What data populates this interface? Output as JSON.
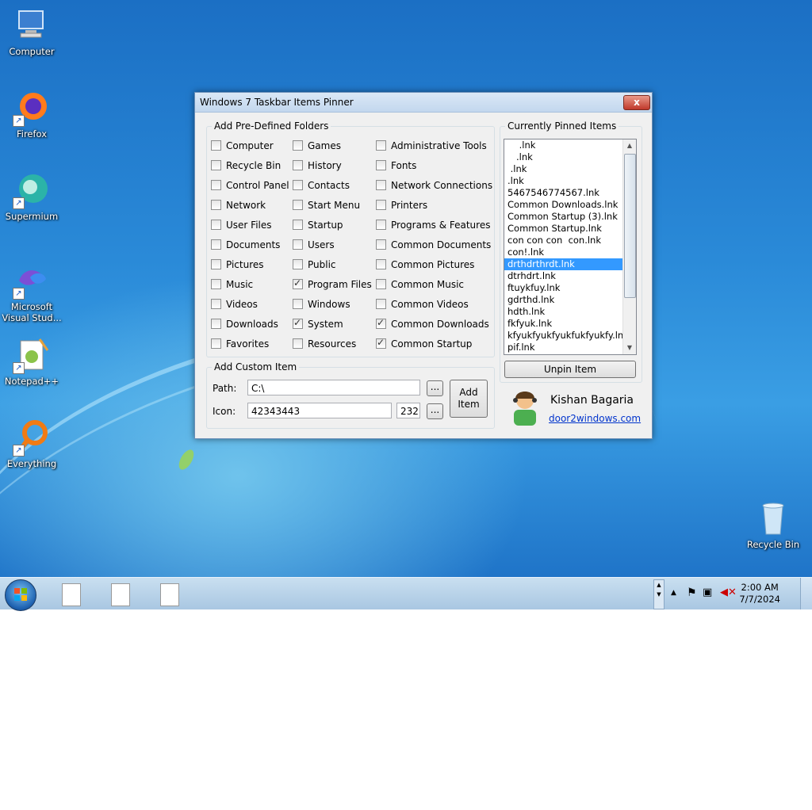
{
  "desktop": {
    "icons": [
      {
        "label": "Computer"
      },
      {
        "label": "Firefox"
      },
      {
        "label": "Supermium"
      },
      {
        "label": "Microsoft Visual Stud..."
      },
      {
        "label": "Notepad++"
      },
      {
        "label": "Everything"
      },
      {
        "label": "Recycle Bin"
      }
    ]
  },
  "window": {
    "title": "Windows 7 Taskbar Items Pinner",
    "close_label": "x",
    "predefined": {
      "label": "Add Pre-Defined Folders",
      "columns": [
        [
          {
            "label": "Computer",
            "checked": false
          },
          {
            "label": "Recycle Bin",
            "checked": false
          },
          {
            "label": "Control Panel",
            "checked": false
          },
          {
            "label": "Network",
            "checked": false
          },
          {
            "label": "User Files",
            "checked": false
          },
          {
            "label": "Documents",
            "checked": false
          },
          {
            "label": "Pictures",
            "checked": false
          },
          {
            "label": "Music",
            "checked": false
          },
          {
            "label": "Videos",
            "checked": false
          },
          {
            "label": "Downloads",
            "checked": false
          },
          {
            "label": "Favorites",
            "checked": false
          }
        ],
        [
          {
            "label": "Games",
            "checked": false
          },
          {
            "label": "History",
            "checked": false
          },
          {
            "label": "Contacts",
            "checked": false
          },
          {
            "label": "Start Menu",
            "checked": false
          },
          {
            "label": "Startup",
            "checked": false
          },
          {
            "label": "Users",
            "checked": false
          },
          {
            "label": "Public",
            "checked": false
          },
          {
            "label": "Program Files",
            "checked": true
          },
          {
            "label": "Windows",
            "checked": false
          },
          {
            "label": "System",
            "checked": true
          },
          {
            "label": "Resources",
            "checked": false
          }
        ],
        [
          {
            "label": "Administrative Tools",
            "checked": false
          },
          {
            "label": "Fonts",
            "checked": false
          },
          {
            "label": "Network Connections",
            "checked": false
          },
          {
            "label": "Printers",
            "checked": false
          },
          {
            "label": "Programs & Features",
            "checked": false
          },
          {
            "label": "Common Documents",
            "checked": false
          },
          {
            "label": "Common Pictures",
            "checked": false
          },
          {
            "label": "Common Music",
            "checked": false
          },
          {
            "label": "Common Videos",
            "checked": false
          },
          {
            "label": "Common Downloads",
            "checked": true
          },
          {
            "label": "Common Startup",
            "checked": true
          }
        ]
      ]
    },
    "custom": {
      "label": "Add Custom Item",
      "path_label": "Path:",
      "path_value": "C:\\",
      "icon_label": "Icon:",
      "icon_value": "42343443",
      "icon_index": "232",
      "browse_label": "...",
      "add_label_1": "Add",
      "add_label_2": "Item"
    },
    "pinned": {
      "label": "Currently Pinned Items",
      "items": [
        "    .lnk",
        "   .lnk",
        " .lnk",
        ".lnk",
        "5467546774567.lnk",
        "Common Downloads.lnk",
        "Common Startup (3).lnk",
        "Common Startup.lnk",
        "con con con  con.lnk",
        "con!.lnk",
        "drthdrthrdt.lnk",
        "dtrhdrt.lnk",
        "ftuykfuy.lnk",
        "gdrthd.lnk",
        "hdth.lnk",
        "fkfyuk.lnk",
        "kfyukfyukfyukfukfyukfy.lnk",
        "pif.lnk"
      ],
      "selected_index": 10,
      "unpin_label": "Unpin Item"
    },
    "author": {
      "name": "Kishan Bagaria",
      "link": "door2windows.com"
    }
  },
  "taskbar": {
    "time": "2:00 AM",
    "date": "7/7/2024"
  }
}
